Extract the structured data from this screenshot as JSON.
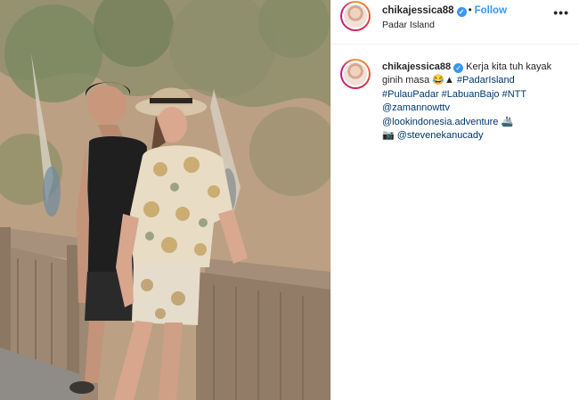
{
  "post": {
    "username": "chikajessica88",
    "follow_label": "Follow",
    "location": "Padar Island",
    "more_label": "•••",
    "verified_glyph": "✓"
  },
  "caption": {
    "username": "chikajessica88",
    "text_line1": "Kerja kita tuh kayak",
    "text_line2_prefix": "ginih masa",
    "emoji": "😂▲",
    "hashtag_padarisland": "#PadarIsland",
    "hashtag_pulaupadar": "#PulauPadar",
    "hashtag_labuanbajo": "#LabuanBajo",
    "hashtag_ntt": "#NTT",
    "mention_zamannowttv": "@zamannowttv",
    "mention_lookindonesia": "@lookindonesia.adventure",
    "ship_emoji": "🚢",
    "camera_emoji": "📷",
    "mention_stevene": "@stevenekanucady"
  },
  "colors": {
    "link": "#00376b",
    "follow": "#3897f0",
    "verified": "#3897f0"
  }
}
